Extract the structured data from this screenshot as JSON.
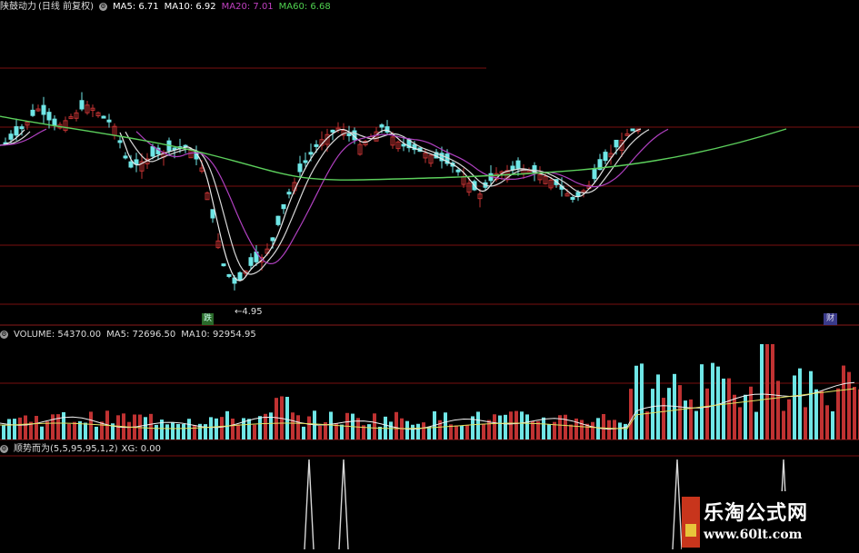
{
  "main_panel": {
    "stock_name": "陕鼓动力",
    "period": "(日线 前复权)",
    "indicators": [
      {
        "label": "MA5: 6.71",
        "color": "#ffffff"
      },
      {
        "label": "MA10: 6.92",
        "color": "#ffffff"
      },
      {
        "label": "MA20: 7.01",
        "color": "#c040c0"
      },
      {
        "label": "MA60: 6.68",
        "color": "#4fd14f"
      }
    ],
    "low_marker": "4.95",
    "badge_left": "跌",
    "badge_right": "财"
  },
  "volume_panel": {
    "label": "VOLUME: 54370.00",
    "ma5": "MA5: 72696.50",
    "ma10": "MA10: 92954.95"
  },
  "signal_panel": {
    "label": "顺势而为(5,5,95,95,1,2)",
    "xg": "XG: 0.00"
  },
  "watermark": {
    "title": "乐淘公式网",
    "url": "www.60lt.com"
  },
  "colors": {
    "up": "#c03232",
    "down": "#6fe6e6",
    "ma20": "#b040c0",
    "ma60": "#5ccf5c",
    "grid": "#7a1010"
  }
}
